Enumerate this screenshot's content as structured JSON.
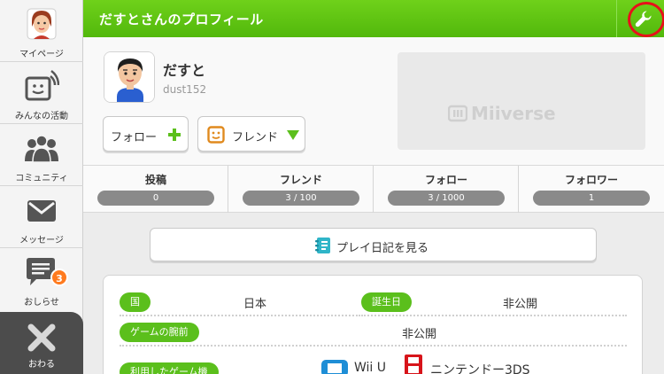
{
  "sidebar": {
    "items": [
      {
        "label": "マイページ"
      },
      {
        "label": "みんなの活動"
      },
      {
        "label": "コミュニティ"
      },
      {
        "label": "メッセージ"
      },
      {
        "label": "おしらせ",
        "badge": "3"
      }
    ],
    "close_label": "おわる"
  },
  "header": {
    "title": "だすとさんのプロフィール"
  },
  "profile": {
    "name": "だすと",
    "user_id": "dust152",
    "follow_label": "フォロー",
    "friend_label": "フレンド",
    "miiverse_logo": "Miiverse"
  },
  "stats": [
    {
      "label": "投稿",
      "value": "0"
    },
    {
      "label": "フレンド",
      "value": "3 / 100"
    },
    {
      "label": "フォロー",
      "value": "3 / 1000"
    },
    {
      "label": "フォロワー",
      "value": "1"
    }
  ],
  "diary_button": "プレイ日記を見る",
  "info": {
    "country_label": "国",
    "country": "日本",
    "birthday_label": "誕生日",
    "birthday": "非公開",
    "skill_label": "ゲームの腕前",
    "skill": "非公開",
    "systems_label": "利用したゲーム機",
    "system1": "Wii U",
    "system2": "ニンテンドー3DS"
  },
  "colors": {
    "accent_green": "#5bbf1c",
    "highlight_ring": "#e8101a",
    "badge_orange": "#ff7a1e"
  }
}
